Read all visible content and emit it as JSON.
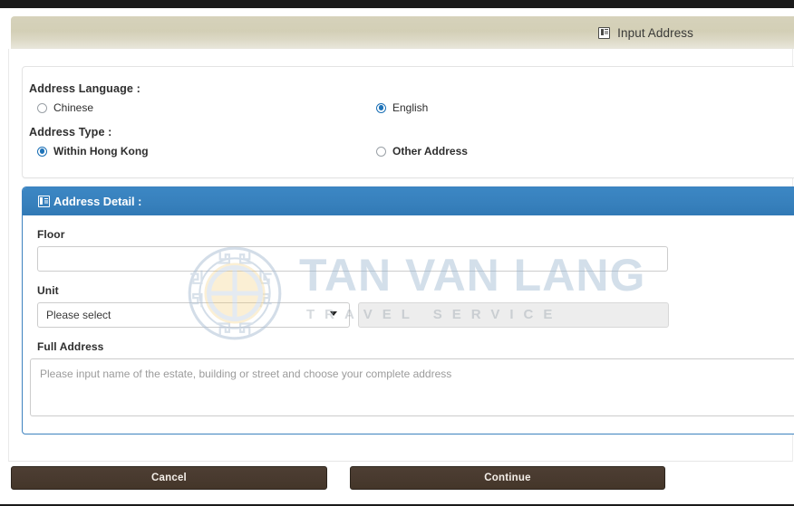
{
  "header": {
    "icon": "list-icon",
    "title": "Input Address"
  },
  "options_panel": {
    "language_label": "Address Language :",
    "language_options": [
      {
        "label": "Chinese",
        "selected": false
      },
      {
        "label": "English",
        "selected": true
      }
    ],
    "type_label": "Address Type :",
    "type_options": [
      {
        "label": "Within Hong Kong",
        "selected": true
      },
      {
        "label": "Other Address",
        "selected": false
      }
    ]
  },
  "detail_panel": {
    "icon": "list-icon",
    "title": "Address Detail :",
    "floor": {
      "label": "Floor",
      "value": "",
      "placeholder": ""
    },
    "unit": {
      "label": "Unit",
      "select_value": "Please select",
      "select_icon": "chevron-down-icon",
      "secondary_value": "",
      "secondary_disabled": true
    },
    "full_address": {
      "label": "Full Address",
      "value": "",
      "placeholder": "Please input name of the estate, building or street and choose your complete address"
    }
  },
  "footer": {
    "cancel_label": "Cancel",
    "continue_label": "Continue"
  },
  "watermark": {
    "brand": "TAN VAN LANG",
    "tagline": "TRAVEL SERVICE"
  },
  "colors": {
    "header_beige": "#d3cfb6",
    "panel_blue": "#3780bc",
    "button_brown": "#493a2f",
    "radio_blue": "#1f74b9",
    "disabled_gray": "#ededed"
  }
}
